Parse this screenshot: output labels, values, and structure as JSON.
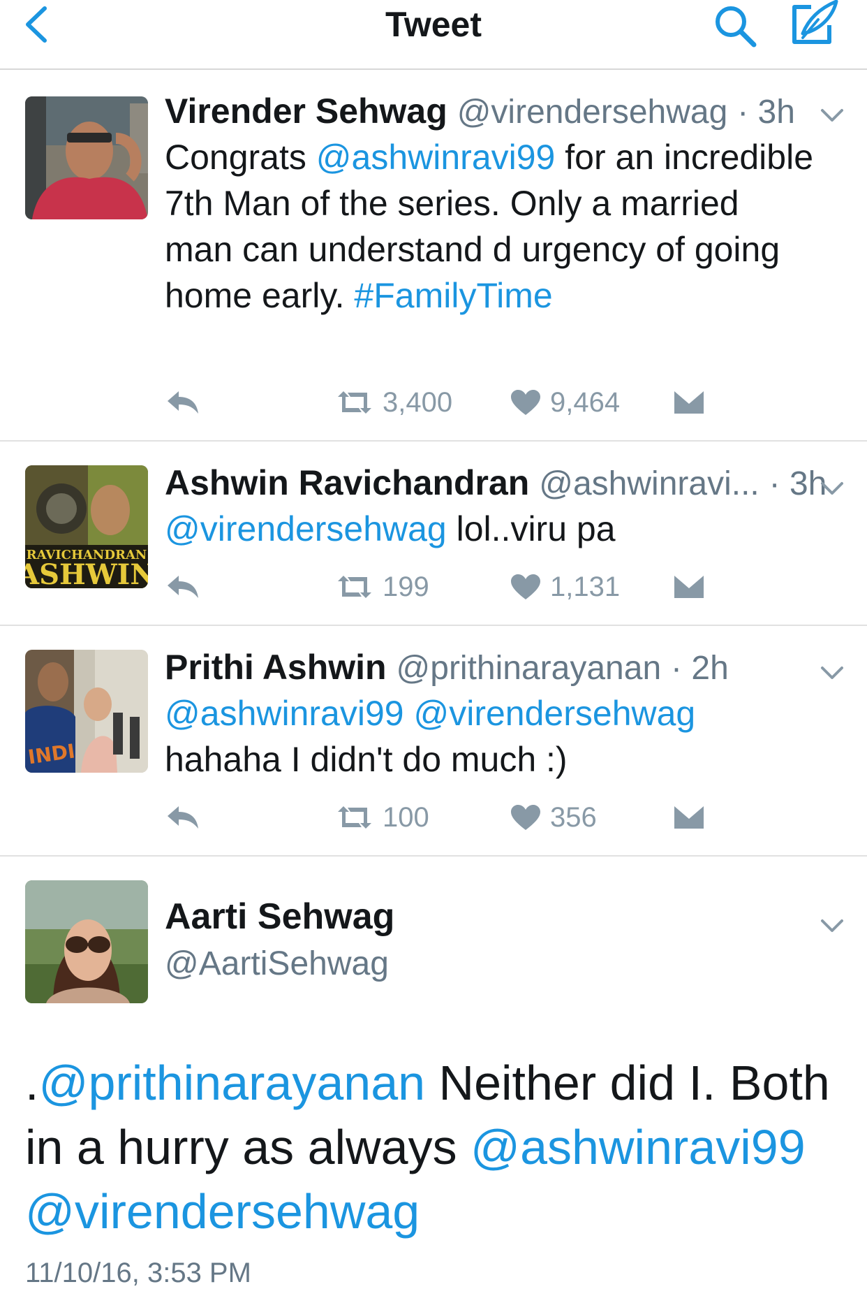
{
  "nav": {
    "title": "Tweet",
    "back_icon": "chevron-left-icon",
    "search_icon": "search-icon",
    "compose_icon": "compose-tweet-icon",
    "accent_color": "#1b95e0"
  },
  "tweets": [
    {
      "name": "Virender Sehwag",
      "handle": "@virendersehwag",
      "time": "· 3h",
      "text": {
        "t1": "Congrats ",
        "m1": "@ashwinravi99",
        "t2": " for an incredible 7th Man of the series. Only a married man can understand d urgency of going home early. ",
        "h1": "#FamilyTime"
      },
      "retweets": "3,400",
      "likes": "9,464"
    },
    {
      "name": "Ashwin Ravichandran",
      "handle": "@ashwinravi...",
      "time": "· 3h",
      "avatar_text_top": "RAVICHANDRAN",
      "avatar_text_bottom": "ASHWIN",
      "text": {
        "m1": "@virendersehwag",
        "t1": " lol..viru pa"
      },
      "retweets": "199",
      "likes": "1,131"
    },
    {
      "name": "Prithi Ashwin",
      "handle": "@prithinarayanan",
      "time": "· 2h",
      "avatar_text": "INDI",
      "text": {
        "m1": "@ashwinravi99",
        "m2": "@virendersehwag",
        "t1": "hahaha I didn't do much :)"
      },
      "retweets": "100",
      "likes": "356"
    }
  ],
  "detail": {
    "name": "Aarti Sehwag",
    "handle": "@AartiSehwag",
    "text": {
      "t0": ".",
      "m1": "@prithinarayanan",
      "t1": " Neither did I. Both in a hurry as always ",
      "m2": "@ashwinravi99",
      "m3": "@virendersehwag"
    },
    "date": "11/10/16, 3:53 PM"
  }
}
